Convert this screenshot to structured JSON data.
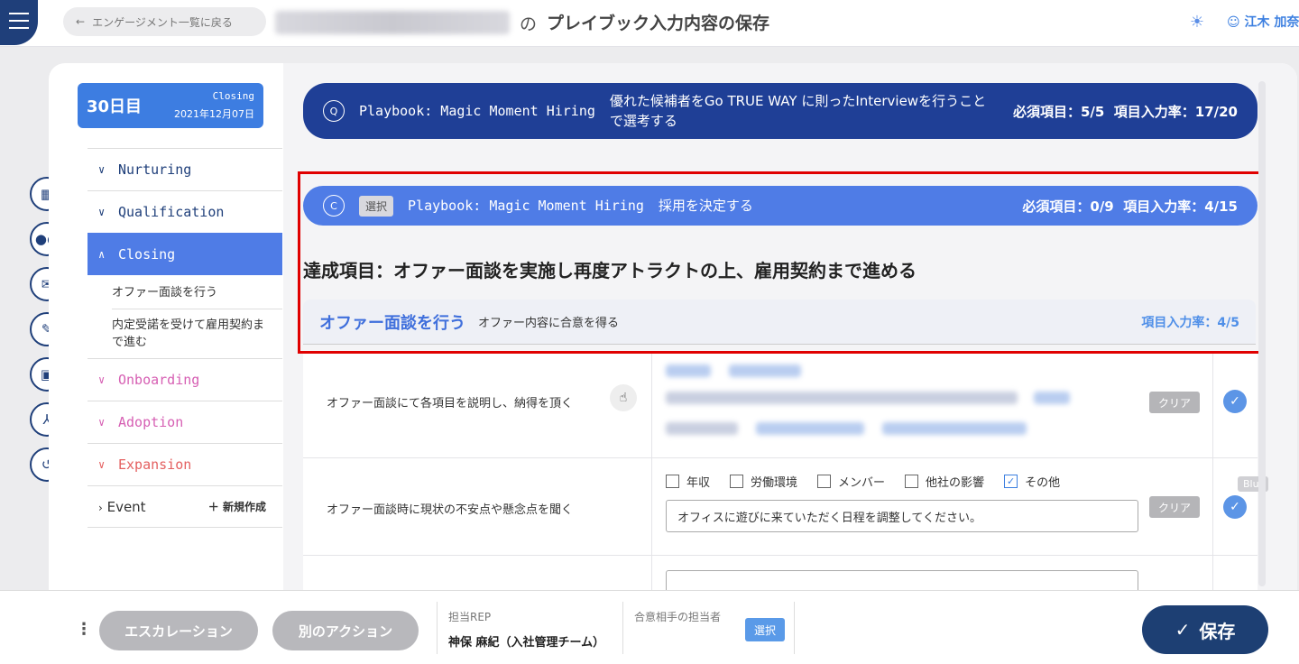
{
  "header": {
    "back_label": "エンゲージメント一覧に戻る",
    "title_particle": "の",
    "title": "プレイブック入力内容の保存",
    "user_name": "江木 加奈"
  },
  "stage": {
    "day": "30日目",
    "name": "Closing",
    "date": "2021年12月07日"
  },
  "sidebar": {
    "items": [
      {
        "label": "Nurturing"
      },
      {
        "label": "Qualification"
      },
      {
        "label": "Closing"
      },
      {
        "label": "Onboarding"
      },
      {
        "label": "Adoption"
      },
      {
        "label": "Expansion"
      },
      {
        "label": "Event"
      }
    ],
    "closing_subitems": [
      "オファー面談を行う",
      "内定受諾を受けて雇用契約まで進む"
    ],
    "new_create": "新規作成"
  },
  "banner1": {
    "tag": "Q",
    "playbook": "Playbook: Magic Moment Hiring",
    "goal": "優れた候補者をGo TRUE WAY に則ったInterviewを行うことで選考する",
    "required": "必須項目：5/5",
    "rate": "項目入力率：17/20"
  },
  "banner2": {
    "tag": "C",
    "select": "選択",
    "playbook": "Playbook: Magic Moment Hiring",
    "goal": "採用を決定する",
    "required": "必須項目：0/9",
    "rate": "項目入力率：4/15"
  },
  "goal_title": "達成項目：オファー面談を実施し再度アトラクトの上、雇用契約まで進める",
  "section": {
    "title": "オファー面談を行う",
    "subtitle": "オファー内容に合意を得る",
    "rate": "項目入力率：4/5"
  },
  "rows": [
    {
      "label": "オファー面談にて各項目を説明し、納得を頂く",
      "clear": "クリア"
    },
    {
      "label": "オファー面談時に現状の不安点や懸念点を聞く",
      "clear": "クリア",
      "options": [
        "年収",
        "労働環境",
        "メンバー",
        "他社の影響",
        "その他"
      ],
      "input_value": "オフィスに遊びに来ていただく日程を調整してください。"
    }
  ],
  "blur_tag": "Blur",
  "footer": {
    "escalation": "エスカレーション",
    "other_action": "別のアクション",
    "rep_label": "担当REP",
    "rep_name": "神保 麻紀（入社管理チーム）",
    "counterpart_label": "合意相手の担当者",
    "select": "選択",
    "save": "保存"
  },
  "colors": {
    "navy": "#1f3f7a",
    "accent": "#4f7ce6",
    "highlight": "#e00000"
  }
}
